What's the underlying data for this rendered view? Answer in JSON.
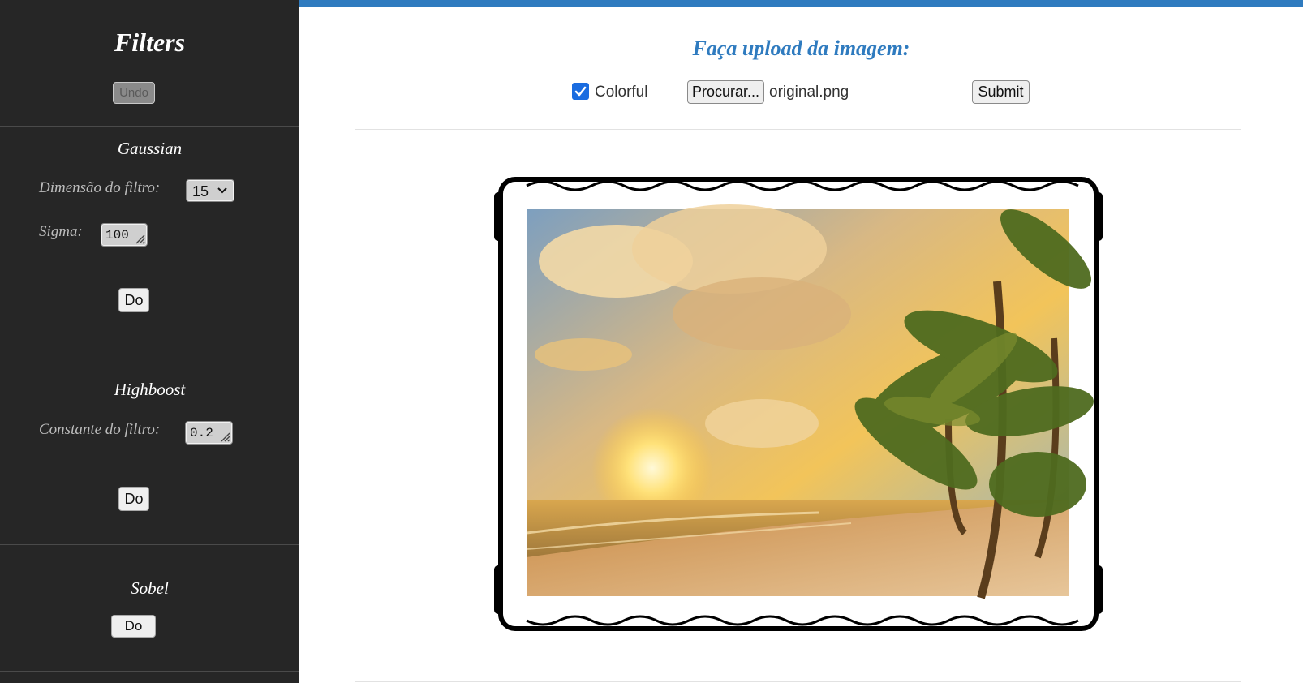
{
  "sidebar": {
    "title": "Filters",
    "undo_label": "Undo",
    "gaussian": {
      "title": "Gaussian",
      "dimension_label": "Dimensão do filtro:",
      "dimension_value": "15",
      "sigma_label": "Sigma:",
      "sigma_value": "100",
      "do_label": "Do"
    },
    "highboost": {
      "title": "Highboost",
      "constant_label": "Constante do filtro:",
      "constant_value": "0.2",
      "do_label": "Do"
    },
    "sobel": {
      "title": "Sobel",
      "do_label": "Do"
    }
  },
  "main": {
    "upload_title": "Faça upload da imagem:",
    "colorful_label": "Colorful",
    "colorful_checked": true,
    "browse_label": "Procurar...",
    "file_name": "original.png",
    "submit_label": "Submit"
  },
  "colors": {
    "accent": "#2f7bbf",
    "sidebar_bg": "#262626",
    "checkbox": "#1a6ce0"
  }
}
